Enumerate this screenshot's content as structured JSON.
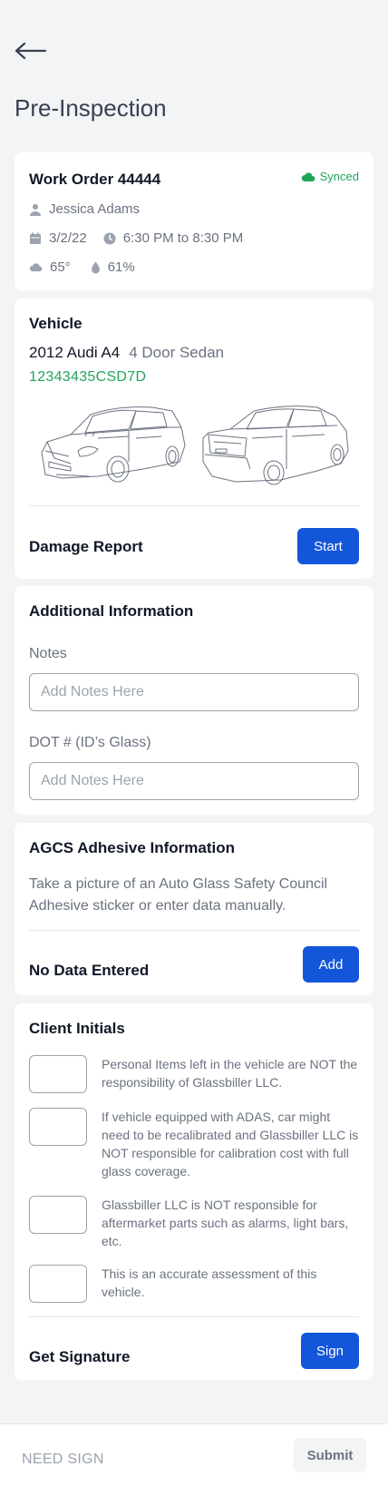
{
  "header": {
    "title": "Pre-Inspection",
    "back_icon": "arrow-left-icon"
  },
  "work_order": {
    "title": "Work Order 44444",
    "sync_status": "Synced",
    "customer": "Jessica Adams",
    "date": "3/2/22",
    "time": "6:30 PM to 8:30 PM",
    "temperature": "65°",
    "humidity": "61%"
  },
  "vehicle": {
    "title": "Vehicle",
    "name": "2012 Audi A4",
    "body": "4 Door Sedan",
    "vin": "12343435CSD7D",
    "damage_label": "Damage Report",
    "start_label": "Start"
  },
  "additional": {
    "title": "Additional Information",
    "notes_label": "Notes",
    "notes_placeholder": "Add Notes Here",
    "dot_label": "DOT # (ID’s Glass)",
    "dot_placeholder": "Add Notes Here"
  },
  "agcs": {
    "title": "AGCS Adhesive Information",
    "description": "Take a picture of an Auto Glass Safety Council Adhesive sticker or enter data manually.",
    "status_label": "No Data Entered",
    "add_label": "Add"
  },
  "initials": {
    "title": "Client Initials",
    "items": [
      "Personal Items left in the vehicle are NOT the responsibility of Glassbiller LLC.",
      "If vehicle equipped with ADAS, car might need to be recalibrated and Glassbiller LLC is NOT responsible for calibration cost with full glass coverage.",
      "Glassbiller LLC is NOT responsible for aftermarket parts such as alarms, light bars, etc.",
      "This is an accurate assessment of this vehicle."
    ],
    "signature_label": "Get Signature",
    "sign_label": "Sign"
  },
  "footer": {
    "status": "NEED SIGN",
    "submit_label": "Submit"
  },
  "colors": {
    "accent": "#1456d9",
    "success": "#22a55b"
  }
}
